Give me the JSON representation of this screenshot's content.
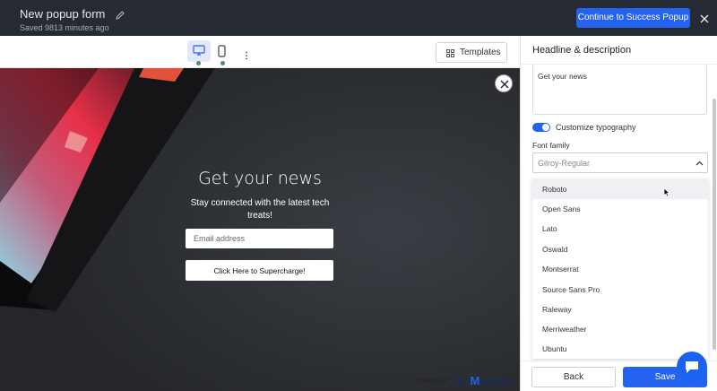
{
  "header": {
    "form_title": "New popup form",
    "saved_status": "Saved 9813 minutes ago",
    "continue_label": "Continue to Success Popup"
  },
  "toolbar": {
    "templates_label": "Templates",
    "active_device": "desktop"
  },
  "popup": {
    "headline": "Get your news",
    "description": "Stay connected with the latest tech treats!",
    "email_placeholder": "Email address",
    "cta_label": "Click Here to Supercharge!",
    "powered_by": "Powered by",
    "brand_prefix": "the",
    "brand_m": "M",
    "brand_suffix": "arketer"
  },
  "panel": {
    "title": "Headline & description",
    "headline_value": "Get your news",
    "customize_typography_label": "Customize typography",
    "customize_typography_on": true,
    "font_family_label": "Font family",
    "font_family_value": "Gilroy-Regular",
    "font_options": [
      "Roboto",
      "Open Sans",
      "Lato",
      "Oswald",
      "Montserrat",
      "Source Sans Pro",
      "Raleway",
      "Merriweather",
      "Ubuntu"
    ],
    "hovered_option": "Roboto",
    "back_label": "Back",
    "save_label": "Save"
  },
  "colors": {
    "topbar": "#262a33",
    "accent": "#2462f0",
    "preview_bg": "#2b2e33"
  }
}
